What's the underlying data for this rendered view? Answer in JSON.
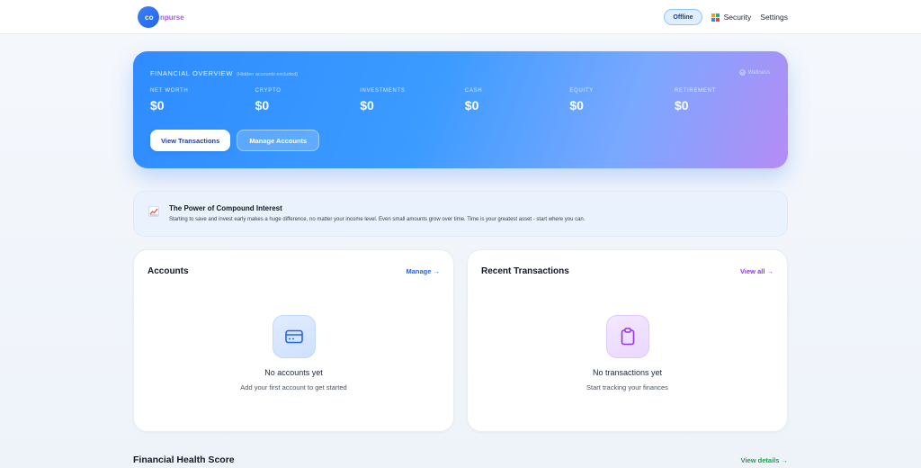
{
  "header": {
    "logo_mark": "co",
    "logo_word": "npurse",
    "status_badge": "Offline",
    "nav": {
      "security": "Security",
      "settings": "Settings"
    }
  },
  "overview": {
    "title": "FINANCIAL OVERVIEW",
    "subtitle": "(Hidden accounts excluded)",
    "wellness_label": "Wellness",
    "metrics": [
      {
        "label": "NET WORTH",
        "value": "$0"
      },
      {
        "label": "CRYPTO",
        "value": "$0"
      },
      {
        "label": "INVESTMENTS",
        "value": "$0"
      },
      {
        "label": "CASH",
        "value": "$0"
      },
      {
        "label": "EQUITY",
        "value": "$0"
      },
      {
        "label": "RETIREMENT",
        "value": "$0"
      }
    ],
    "buttons": {
      "view_transactions": "View Transactions",
      "manage_accounts": "Manage Accounts"
    }
  },
  "tip": {
    "title": "The Power of Compound Interest",
    "body": "Starting to save and invest early makes a huge difference, no matter your income level. Even small amounts grow over time. Time is your greatest asset - start where you can."
  },
  "accounts": {
    "title": "Accounts",
    "link": "Manage →",
    "empty_title": "No accounts yet",
    "empty_sub": "Add your first account to get started"
  },
  "transactions": {
    "title": "Recent Transactions",
    "link": "View all →",
    "empty_title": "No transactions yet",
    "empty_sub": "Start tracking your finances"
  },
  "health": {
    "title": "Financial Health Score",
    "link": "View details →"
  },
  "colors": {
    "primary": "#3b82f6",
    "accent_purple": "#a855f7",
    "success": "#16a34a"
  }
}
